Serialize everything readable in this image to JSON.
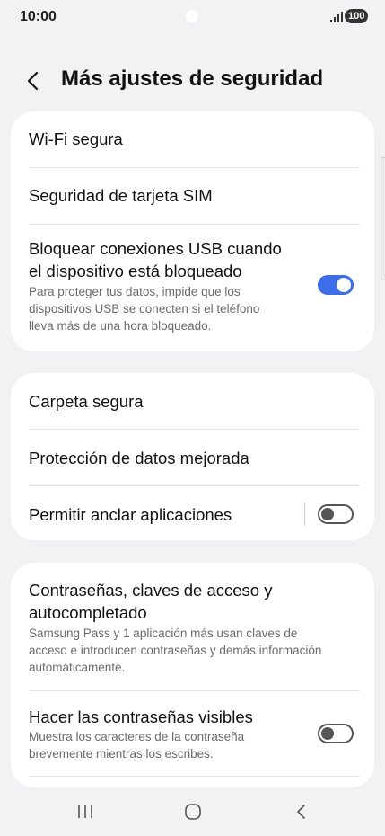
{
  "status_bar": {
    "time": "10:00",
    "battery": "100",
    "signal_icon": "signal-bars-icon"
  },
  "header": {
    "title": "Más ajustes de seguridad",
    "back_icon": "chevron-left-icon"
  },
  "card1": {
    "wifi": {
      "title": "Wi-Fi segura"
    },
    "sim": {
      "title": "Seguridad de tarjeta SIM"
    },
    "usb": {
      "title_line1": "Bloquear conexiones USB cuando",
      "title_line2": "el dispositivo está bloqueado",
      "sub_line1": "Para proteger tus datos, impide que los",
      "sub_line2": "dispositivos USB se conecten si el teléfono",
      "sub_line3": "lleva más de una hora bloqueado.",
      "toggle": "on"
    }
  },
  "card2": {
    "folder": {
      "title": "Carpeta segura"
    },
    "data_protection": {
      "title": "Protección de datos mejorada"
    },
    "pin_apps": {
      "title": "Permitir anclar aplicaciones",
      "toggle": "off"
    }
  },
  "card3": {
    "passwords": {
      "title_line1": "Contraseñas, claves de acceso y",
      "title_line2": "autocompletado",
      "sub_line1": "Samsung Pass y 1 aplicación más usan claves de",
      "sub_line2": "acceso e introducen contraseñas y demás información",
      "sub_line3": "automáticamente."
    },
    "visible_passwords": {
      "title": "Hacer las contraseñas visibles",
      "sub_line1": "Muestra los caracteres de la contraseña",
      "sub_line2": "brevemente mientras los escribes.",
      "toggle": "off"
    }
  },
  "nav_bar": {
    "recents_icon": "recent-apps-icon",
    "home_icon": "home-icon",
    "back_icon": "back-icon"
  },
  "colors": {
    "accent": "#3d6ee8",
    "background": "#f2f2f4",
    "card": "#ffffff"
  }
}
